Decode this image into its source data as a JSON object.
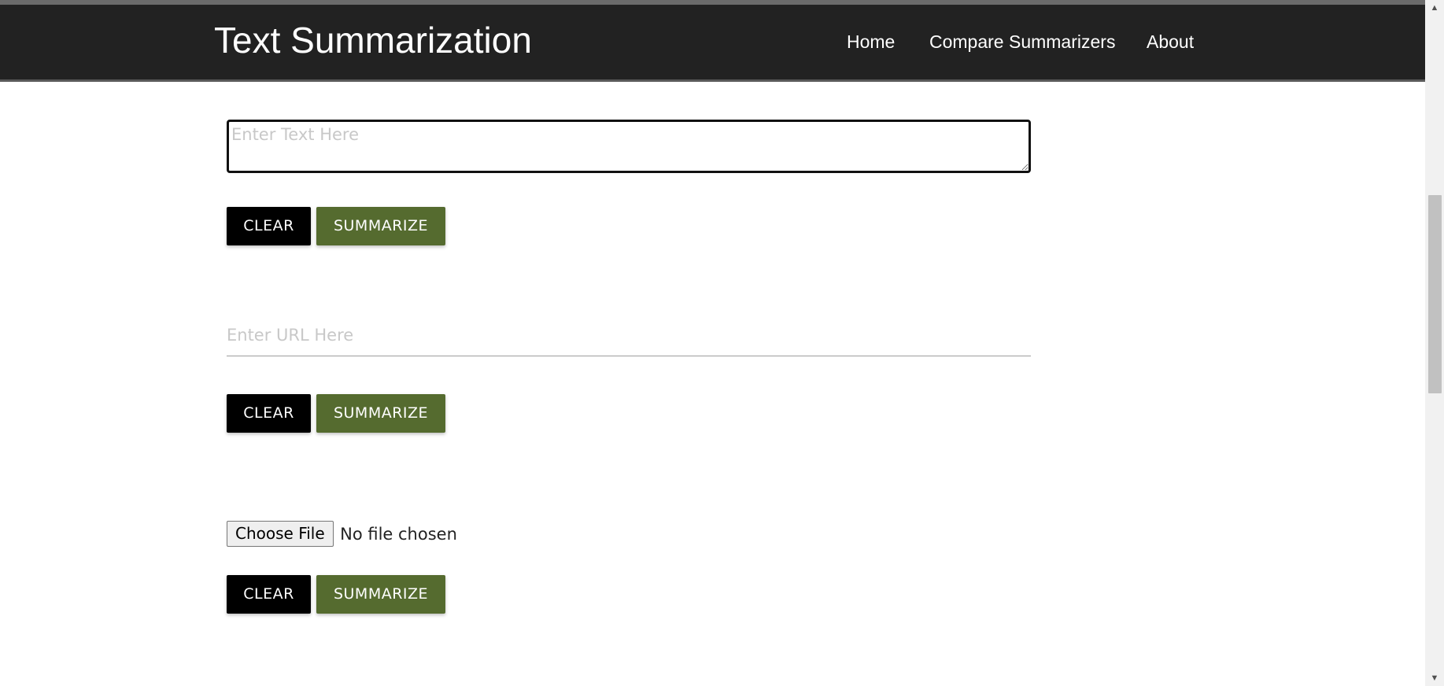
{
  "header": {
    "brand": "Text Summarization",
    "nav": {
      "home": "Home",
      "compare": "Compare Summarizers",
      "about": "About"
    }
  },
  "text_section": {
    "placeholder": "Enter Text Here",
    "clear_label": "CLEAR",
    "summarize_label": "SUMMARIZE"
  },
  "url_section": {
    "placeholder": "Enter URL Here",
    "clear_label": "CLEAR",
    "summarize_label": "SUMMARIZE"
  },
  "file_section": {
    "choose_label": "Choose File",
    "status": "No file chosen",
    "clear_label": "CLEAR",
    "summarize_label": "SUMMARIZE"
  },
  "colors": {
    "navbar": "#222222",
    "clear_button": "#000000",
    "summarize_button": "#556b2f"
  },
  "scrollbar": {
    "up_icon": "arrow-up-icon",
    "down_icon": "arrow-down-icon"
  }
}
